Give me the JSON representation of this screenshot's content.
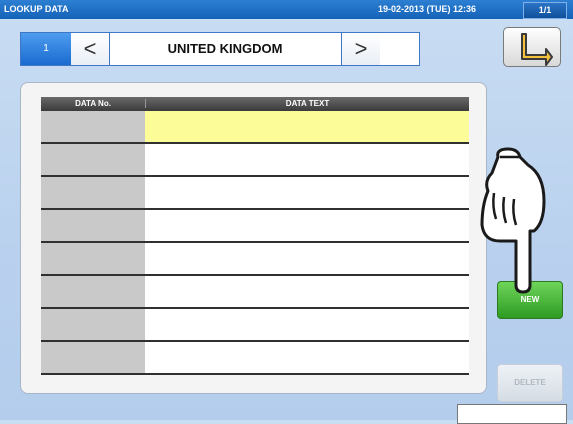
{
  "titlebar": {
    "title": "LOOKUP DATA",
    "datetime": "19-02-2013 (TUE) 12:36",
    "page": "1/1"
  },
  "nav": {
    "number": "1",
    "prev_label": "<",
    "next_label": ">",
    "country": "UNITED KINGDOM"
  },
  "table": {
    "headers": [
      "DATA No.",
      "DATA TEXT"
    ],
    "rows": [
      {
        "no": "",
        "text": ""
      },
      {
        "no": "",
        "text": ""
      },
      {
        "no": "",
        "text": ""
      },
      {
        "no": "",
        "text": ""
      },
      {
        "no": "",
        "text": ""
      },
      {
        "no": "",
        "text": ""
      },
      {
        "no": "",
        "text": ""
      },
      {
        "no": "",
        "text": ""
      }
    ]
  },
  "buttons": {
    "new": "NEW",
    "delete": "DELETE"
  },
  "icons": {
    "back": "return-arrow-icon",
    "pointer": "pointing-hand-icon"
  },
  "colors": {
    "titlebar": "#1f6fc5",
    "selected_row": "#fcfc99",
    "new_button": "#3aa82d"
  }
}
